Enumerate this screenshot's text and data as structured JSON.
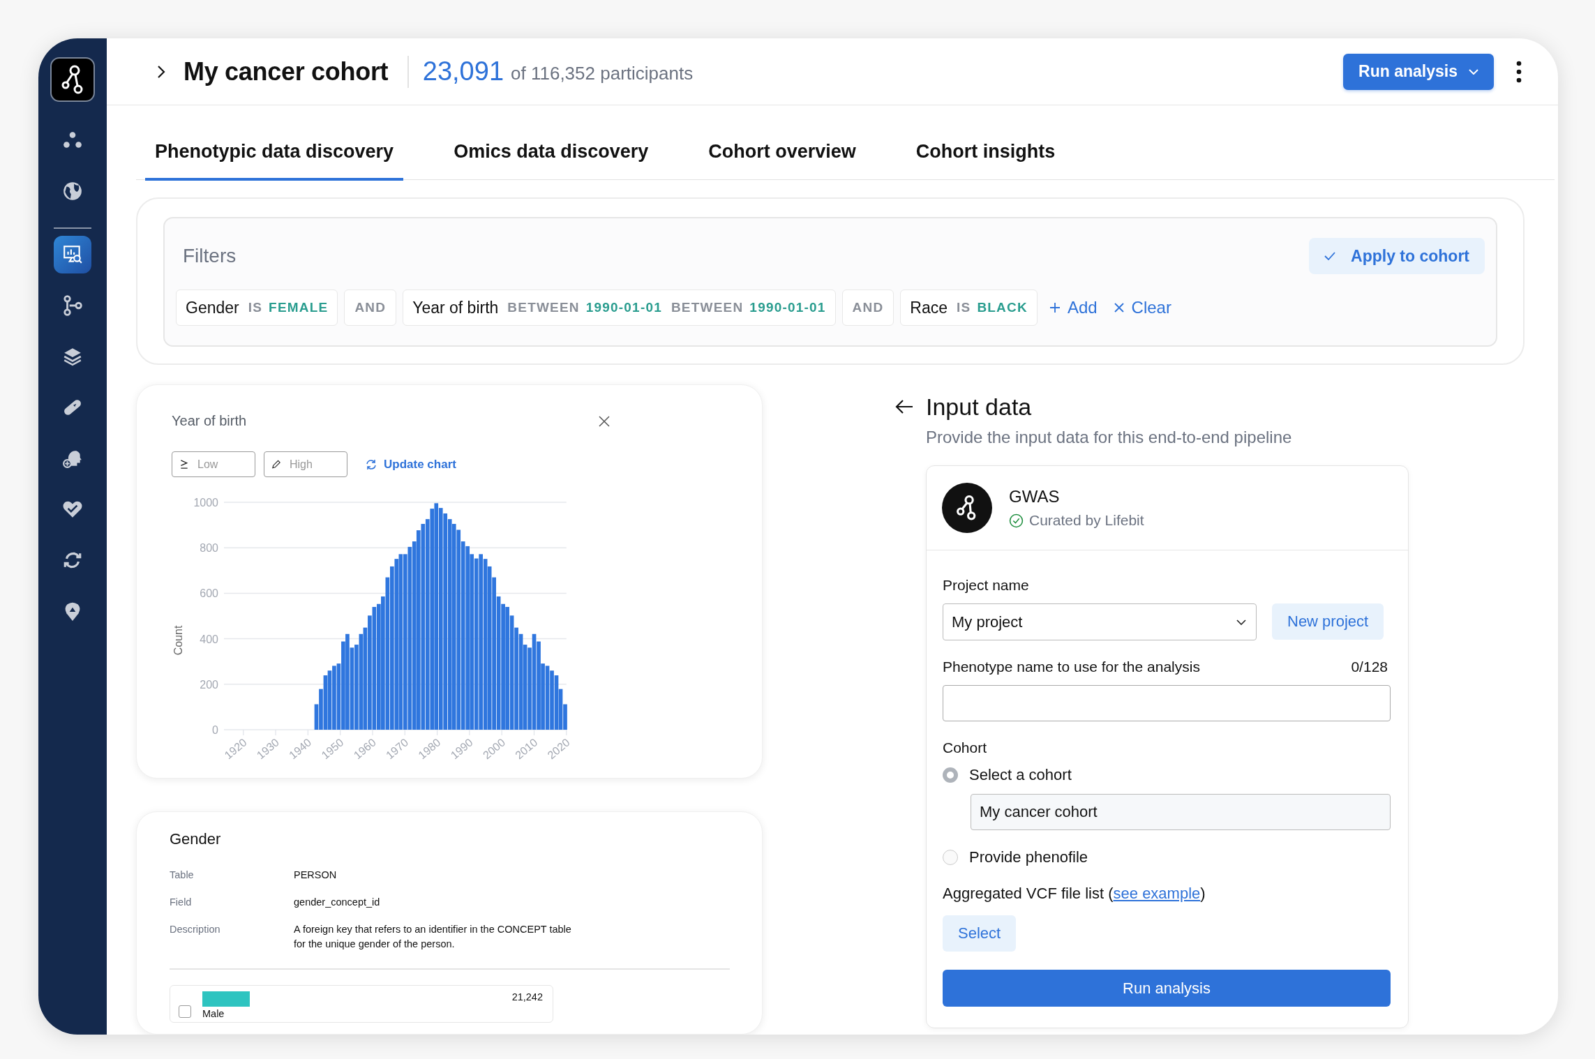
{
  "sidebar": {
    "items": [
      {
        "kind": "dots",
        "selected": false
      },
      {
        "kind": "globe",
        "selected": false
      },
      {
        "kind": "analysis",
        "selected": true
      },
      {
        "kind": "branch",
        "selected": false
      },
      {
        "kind": "layers",
        "selected": false
      },
      {
        "kind": "pill",
        "selected": false
      },
      {
        "kind": "head",
        "selected": false
      },
      {
        "kind": "heart",
        "selected": false
      },
      {
        "kind": "sync",
        "selected": false
      },
      {
        "kind": "pin",
        "selected": false
      }
    ]
  },
  "header": {
    "title": "My cancer cohort",
    "count": "23,091",
    "count_suffix": "of 116,352 participants",
    "run_button": "Run analysis"
  },
  "tabs": [
    {
      "label": "Phenotypic data discovery",
      "selected": true
    },
    {
      "label": "Omics data discovery",
      "selected": false
    },
    {
      "label": "Cohort overview",
      "selected": false
    },
    {
      "label": "Cohort insights",
      "selected": false
    }
  ],
  "filters": {
    "title": "Filters",
    "apply_button": "Apply to cohort",
    "add_button": "Add",
    "clear_button": "Clear",
    "chips": [
      {
        "kind": "filter",
        "field": "Gender",
        "parts": [
          {
            "kind": "keyword",
            "text": "IS"
          },
          {
            "kind": "value",
            "text": "FEMALE"
          }
        ]
      },
      {
        "kind": "operator",
        "text": "AND"
      },
      {
        "kind": "filter",
        "field": "Year of birth",
        "parts": [
          {
            "kind": "keyword",
            "text": "BETWEEN"
          },
          {
            "kind": "value",
            "text": "1990-01-01"
          },
          {
            "kind": "keyword",
            "text": "BETWEEN"
          },
          {
            "kind": "value",
            "text": "1990-01-01"
          }
        ]
      },
      {
        "kind": "operator",
        "text": "AND"
      },
      {
        "kind": "filter",
        "field": "Race",
        "parts": [
          {
            "kind": "keyword",
            "text": "IS"
          },
          {
            "kind": "value",
            "text": "BLACK"
          }
        ]
      }
    ]
  },
  "chart_card": {
    "title": "Year of birth",
    "low_placeholder": "Low",
    "high_placeholder": "High",
    "update_button": "Update chart",
    "chart_data": {
      "type": "bar",
      "ylabel": "Count",
      "grid": true,
      "xlim": [
        1914,
        2020
      ],
      "ylim": [
        0,
        1000
      ],
      "xticks": [
        1920,
        1930,
        1940,
        1950,
        1960,
        1970,
        1980,
        1990,
        2000,
        2010,
        2020
      ],
      "yticks": [
        0,
        200,
        400,
        600,
        800,
        1000
      ],
      "x": [
        1942,
        1943.4,
        1944.8,
        1946.1,
        1947.5,
        1948.9,
        1950.3,
        1951.6,
        1953,
        1954.4,
        1955.8,
        1957.1,
        1958.5,
        1959.9,
        1961.3,
        1962.6,
        1964,
        1965.4,
        1966.8,
        1968.1,
        1969.5,
        1970.9,
        1972.3,
        1973.6,
        1975,
        1976.4,
        1977.8,
        1979.1,
        1980.5,
        1981.9,
        1983.3,
        1984.6,
        1986,
        1987.4,
        1988.8,
        1990.1,
        1991.5,
        1992.9,
        1994.3,
        1995.6,
        1997,
        1998.4,
        1999.8,
        2001.1,
        2002.5,
        2003.9,
        2005.3,
        2006.6,
        2008,
        2009.4,
        2010.8,
        2012.1,
        2013.5,
        2014.9,
        2016.3,
        2017.6,
        2019
      ],
      "series": [
        {
          "color": "#2f76de",
          "values": [
            112,
            179,
            239,
            260,
            281,
            291,
            388,
            421,
            361,
            374,
            421,
            449,
            502,
            540,
            553,
            586,
            670,
            718,
            751,
            772,
            772,
            804,
            828,
            877,
            905,
            926,
            972,
            996,
            975,
            951,
            926,
            905,
            879,
            828,
            807,
            772,
            753,
            772,
            751,
            718,
            670,
            586,
            553,
            540,
            502,
            449,
            421,
            374,
            361,
            421,
            388,
            291,
            281,
            260,
            239,
            179,
            112
          ]
        }
      ]
    }
  },
  "gender_card": {
    "title": "Gender",
    "details": [
      {
        "label": "Table",
        "value": "PERSON"
      },
      {
        "label": "Field",
        "value": "gender_concept_id"
      },
      {
        "label": "Description",
        "value": "A foreign key that refers to an identifier in the CONCEPT table for the unique gender of the person."
      }
    ],
    "options": [
      {
        "label": "Male",
        "count": "21,242",
        "checked": false,
        "color": "#2ec4c0",
        "level": 0.16
      }
    ]
  },
  "input_panel": {
    "title": "Input data",
    "subtitle": "Provide the input data for this end-to-end pipeline",
    "pipeline": {
      "name": "GWAS",
      "curator": "Curated by Lifebit"
    },
    "project_label": "Project name",
    "project_value": "My project",
    "new_project_button": "New project",
    "phenotype_label": "Phenotype name to use for the analysis",
    "phenotype_counter": "0/128",
    "cohort_label": "Cohort",
    "cohort_options": [
      {
        "label": "Select a cohort",
        "selected": true,
        "value": "My cancer cohort"
      },
      {
        "label": "Provide phenofile",
        "selected": false
      }
    ],
    "vcf_label": "Aggregated VCF file list (",
    "vcf_link": "see example",
    "vcf_suffix": ")",
    "select_button": "Select",
    "run_button": "Run analysis"
  }
}
